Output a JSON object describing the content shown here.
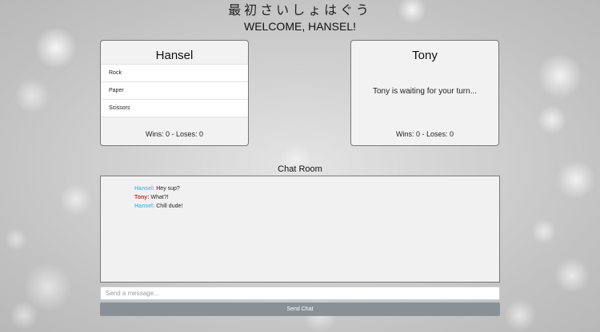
{
  "header": {
    "title_jp": "最初さいしょはぐう",
    "welcome": "WELCOME, HANSEL!"
  },
  "player": {
    "name": "Hansel",
    "choices": [
      "Rock",
      "Paper",
      "Scissors"
    ],
    "score": "Wins: 0 - Loses: 0"
  },
  "opponent": {
    "name": "Tony",
    "status": "Tony is waiting for your turn...",
    "score": "Wins: 0 - Loses: 0"
  },
  "chat": {
    "title": "Chat Room",
    "messages": [
      {
        "name": "Hansel:",
        "text": "Hey sup?",
        "color": "#5bc0de"
      },
      {
        "name": "Tony:",
        "text": "What?!",
        "color": "#c9302c"
      },
      {
        "name": "Hansel:",
        "text": "Chill dude!",
        "color": "#5bc0de"
      }
    ],
    "input_placeholder": "Send a message...",
    "send_label": "Send Chat"
  },
  "colors": {
    "hansel": "#5bc0de",
    "tony": "#c9302c",
    "send_button": "#8a9196"
  }
}
